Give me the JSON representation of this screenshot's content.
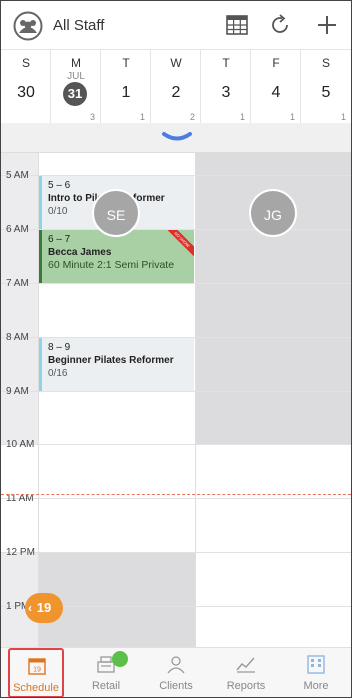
{
  "header": {
    "staff_filter_label": "All Staff",
    "icons": [
      "staff-group-icon",
      "calendar-grid-icon",
      "refresh-icon",
      "add-icon"
    ]
  },
  "week": {
    "days": [
      {
        "dow": "S",
        "month": "",
        "date": "30",
        "count": ""
      },
      {
        "dow": "M",
        "month": "JUL",
        "date": "31",
        "count": "3",
        "selected": true
      },
      {
        "dow": "T",
        "month": "",
        "date": "1",
        "count": "1"
      },
      {
        "dow": "W",
        "month": "",
        "date": "2",
        "count": "2"
      },
      {
        "dow": "T",
        "month": "",
        "date": "3",
        "count": "1"
      },
      {
        "dow": "F",
        "month": "",
        "date": "4",
        "count": "1"
      },
      {
        "dow": "S",
        "month": "",
        "date": "5",
        "count": "1"
      }
    ]
  },
  "calendar": {
    "hours": [
      "5 AM",
      "6 AM",
      "7 AM",
      "8 AM",
      "9 AM",
      "10 AM",
      "11 AM",
      "12 PM",
      "1 PM"
    ],
    "staff_columns": [
      {
        "initials": "SE"
      },
      {
        "initials": "JG"
      }
    ],
    "events": [
      {
        "time": "5 – 6",
        "title": "Intro to Pilates Reformer",
        "sub": "0/10",
        "color": "#eceff1",
        "accent": "#8fd3e6"
      },
      {
        "time": "6 – 7",
        "title": "Becca James",
        "sub": "60 Minute 2:1 Semi Private",
        "color": "#a9cfa4",
        "accent": "#3a7a35",
        "ribbon": "NO SHOW"
      },
      {
        "time": "8 – 9",
        "title": "Beginner Pilates Reformer",
        "sub": "0/16",
        "color": "#eceff1",
        "accent": "#8fd3e6"
      }
    ],
    "jump_badge": "19"
  },
  "tabs": [
    {
      "label": "Schedule",
      "icon": "calendar-day-icon",
      "active": true
    },
    {
      "label": "Retail",
      "icon": "register-icon",
      "active": false
    },
    {
      "label": "Clients",
      "icon": "client-icon",
      "active": false
    },
    {
      "label": "Reports",
      "icon": "chart-icon",
      "active": false
    },
    {
      "label": "More",
      "icon": "building-icon",
      "active": false
    }
  ],
  "colors": {
    "accent_orange": "#f0942e",
    "active_tab": "#e0741c",
    "selected_tab_border": "#e0424a",
    "now_line": "#e8775a",
    "notify_dot": "#5bbf4a"
  }
}
